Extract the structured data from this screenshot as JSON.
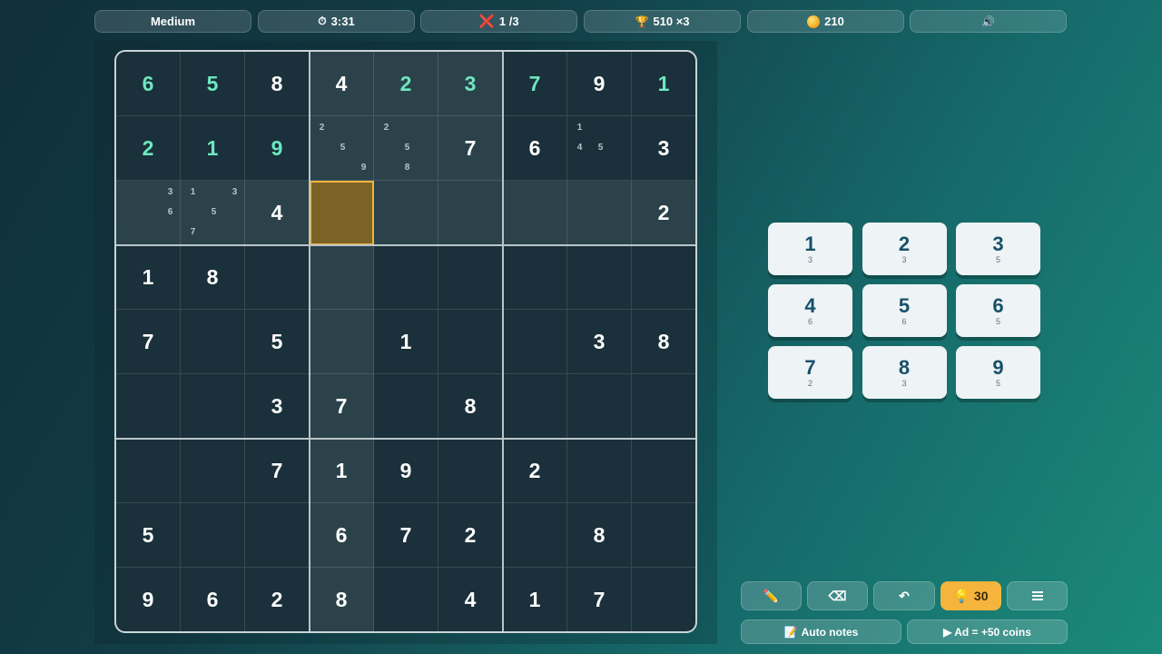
{
  "topbar": {
    "difficulty": "Medium",
    "timer": "3:31",
    "timer_icon": "stopwatch-icon",
    "mistakes": "1 /3",
    "score": "510 ×3",
    "coins": "210",
    "sound_icon": "🔊"
  },
  "board": {
    "rows": [
      [
        "6",
        "5",
        "8",
        "4",
        "2",
        "3",
        "7",
        "9",
        "1"
      ],
      [
        "2",
        "1",
        "9",
        "",
        "",
        "7",
        "6",
        "",
        "3"
      ],
      [
        "",
        "",
        "4",
        "",
        "",
        "",
        "",
        "",
        "2"
      ],
      [
        "1",
        "8",
        "",
        "",
        "",
        "",
        "",
        "",
        ""
      ],
      [
        "7",
        "",
        "5",
        "",
        "1",
        "",
        "",
        "3",
        "8"
      ],
      [
        "",
        "",
        "3",
        "7",
        "",
        "8",
        "",
        "",
        ""
      ],
      [
        "",
        "",
        "7",
        "1",
        "9",
        "",
        "2",
        "",
        ""
      ],
      [
        "5",
        "",
        "",
        "6",
        "7",
        "2",
        "",
        "8",
        ""
      ],
      [
        "9",
        "6",
        "2",
        "8",
        "",
        "4",
        "1",
        "7",
        ""
      ]
    ],
    "green_cells": [
      [
        0,
        0
      ],
      [
        0,
        1
      ],
      [
        0,
        4
      ],
      [
        0,
        5
      ],
      [
        0,
        6
      ],
      [
        0,
        8
      ],
      [
        1,
        0
      ],
      [
        1,
        1
      ],
      [
        1,
        2
      ]
    ],
    "selected": [
      2,
      3
    ],
    "notes": {
      "1-3": [
        "2",
        "",
        "",
        "",
        "5",
        "",
        "",
        "",
        "9"
      ],
      "1-4": [
        "2",
        "",
        "",
        "",
        "5",
        "",
        "",
        "8",
        ""
      ],
      "1-7": [
        "1",
        "",
        "",
        "4",
        "5",
        "",
        "",
        "",
        ""
      ],
      "2-0": [
        "",
        "",
        "3",
        "",
        "",
        "6",
        "",
        "",
        ""
      ],
      "2-1": [
        "1",
        "",
        "3",
        "",
        "5",
        "",
        "7",
        "",
        ""
      ]
    },
    "colors": {
      "selected_border": "#f0b43c",
      "green_digit": "#6fe6c0"
    }
  },
  "pad": {
    "keys": [
      {
        "num": "1",
        "count": "3"
      },
      {
        "num": "2",
        "count": "3"
      },
      {
        "num": "3",
        "count": "5"
      },
      {
        "num": "4",
        "count": "6"
      },
      {
        "num": "5",
        "count": "6"
      },
      {
        "num": "6",
        "count": "5"
      },
      {
        "num": "7",
        "count": "2"
      },
      {
        "num": "8",
        "count": "3"
      },
      {
        "num": "9",
        "count": "5"
      }
    ]
  },
  "tools": {
    "pencil": "✏️",
    "erase": "⌫",
    "undo": "↶",
    "hint_icon": "💡",
    "hint_count": "30",
    "auto_notes": "Auto notes",
    "auto_notes_icon": "📝",
    "ad": "▶ Ad = +50 coins"
  }
}
